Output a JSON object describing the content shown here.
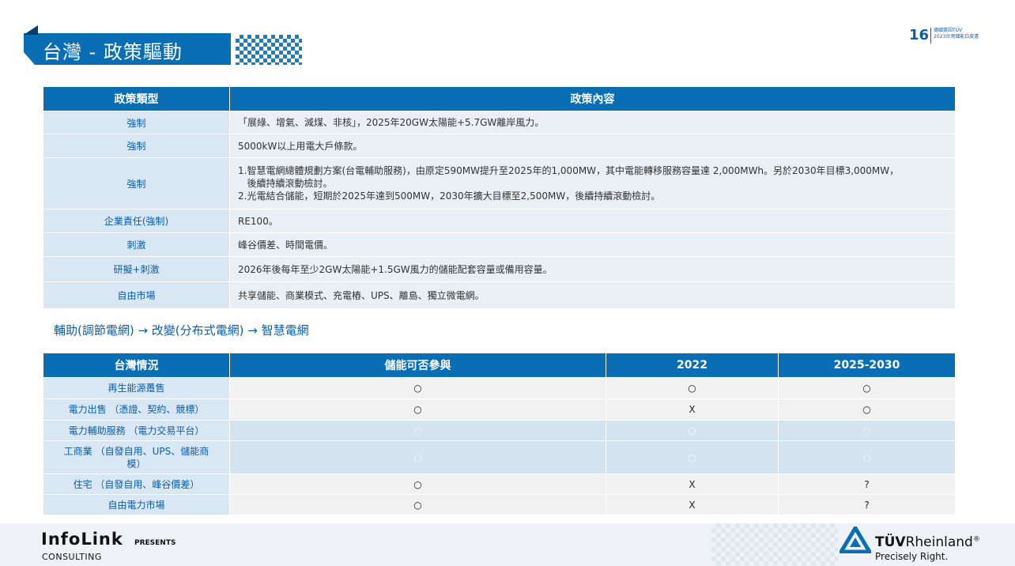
{
  "header": {
    "title": "台灣  -  政策驅動",
    "page_number": "16",
    "meta_line1": "德國萊因TÜV",
    "meta_line2": "2023台灣儲能白皮書"
  },
  "policy_table": {
    "headers": [
      "政策類型",
      "政策內容"
    ],
    "rows": [
      {
        "type": "強制",
        "content": [
          "「展綠、增氣、減煤、非核」，2025年20GW太陽能+5.7GW離岸風力。"
        ]
      },
      {
        "type": "強制",
        "content": [
          "5000kW以上用電大戶條款。"
        ]
      },
      {
        "type": "強制",
        "content": [
          "1.智慧電網總體規劃方案(台電輔助服務)，由原定590MW提升至2025年的1,000MW，其中電能轉移服務容量達 2,000MWh。另於2030年目標3,000MW，",
          "   後續持續滾動檢討。",
          "2.光電結合儲能，短期於2025年達到500MW，2030年擴大目標至2,500MW，後續持續滾動檢討。"
        ]
      },
      {
        "type": "企業責任(強制)",
        "content": [
          "RE100。"
        ]
      },
      {
        "type": "刺激",
        "content": [
          "峰谷價差、時間電價。"
        ]
      },
      {
        "type": "研擬+刺激",
        "content": [
          "2026年後每年至少2GW太陽能+1.5GW風力的儲能配套容量或備用容量。"
        ]
      },
      {
        "type": "自由市場",
        "content": [
          "共享儲能、商業模式、充電樁、UPS、離島、獨立微電網。"
        ]
      }
    ]
  },
  "flow_text": "輔助(調節電網) → 改變(分布式電網) → 智慧電網",
  "situation_table": {
    "headers": [
      "台灣情況",
      "儲能可否參與",
      "2022",
      "2025-2030"
    ],
    "rows": [
      {
        "situation": [
          "再生能源躉售"
        ],
        "cells": [
          "○",
          "○",
          "○"
        ],
        "style": "shaded"
      },
      {
        "situation": [
          "電力出售 （憑證、契約、競標）"
        ],
        "cells": [
          "○",
          "X",
          "○"
        ],
        "style": "shaded"
      },
      {
        "situation": [
          "電力輔助服務 （電力交易平台）"
        ],
        "cells": [
          "○",
          "○",
          "○"
        ],
        "style": "blue"
      },
      {
        "situation": [
          "工商業 （自發自用、UPS、儲能商",
          "模）"
        ],
        "cells": [
          "○",
          "○",
          "○"
        ],
        "style": "blue"
      },
      {
        "situation": [
          "住宅 （自發自用、峰谷價差）"
        ],
        "cells": [
          "○",
          "X",
          "?"
        ],
        "style": "shaded"
      },
      {
        "situation": [
          "自由電力市場"
        ],
        "cells": [
          "○",
          "X",
          "?"
        ],
        "style": "shaded"
      }
    ]
  },
  "footer": {
    "infolink": "InfoLink",
    "presents": "PRESENTS",
    "consulting": "CONSULTING",
    "tuv_bold": "TÜV",
    "tuv_rest": "Rheinland",
    "tuv_reg": "®",
    "tuv_tagline": "Precisely Right."
  },
  "colors": {
    "brand_blue": "#0a6eb5",
    "light_blue_cell": "#d8e7f3",
    "content_cell": "#e8eff5"
  }
}
